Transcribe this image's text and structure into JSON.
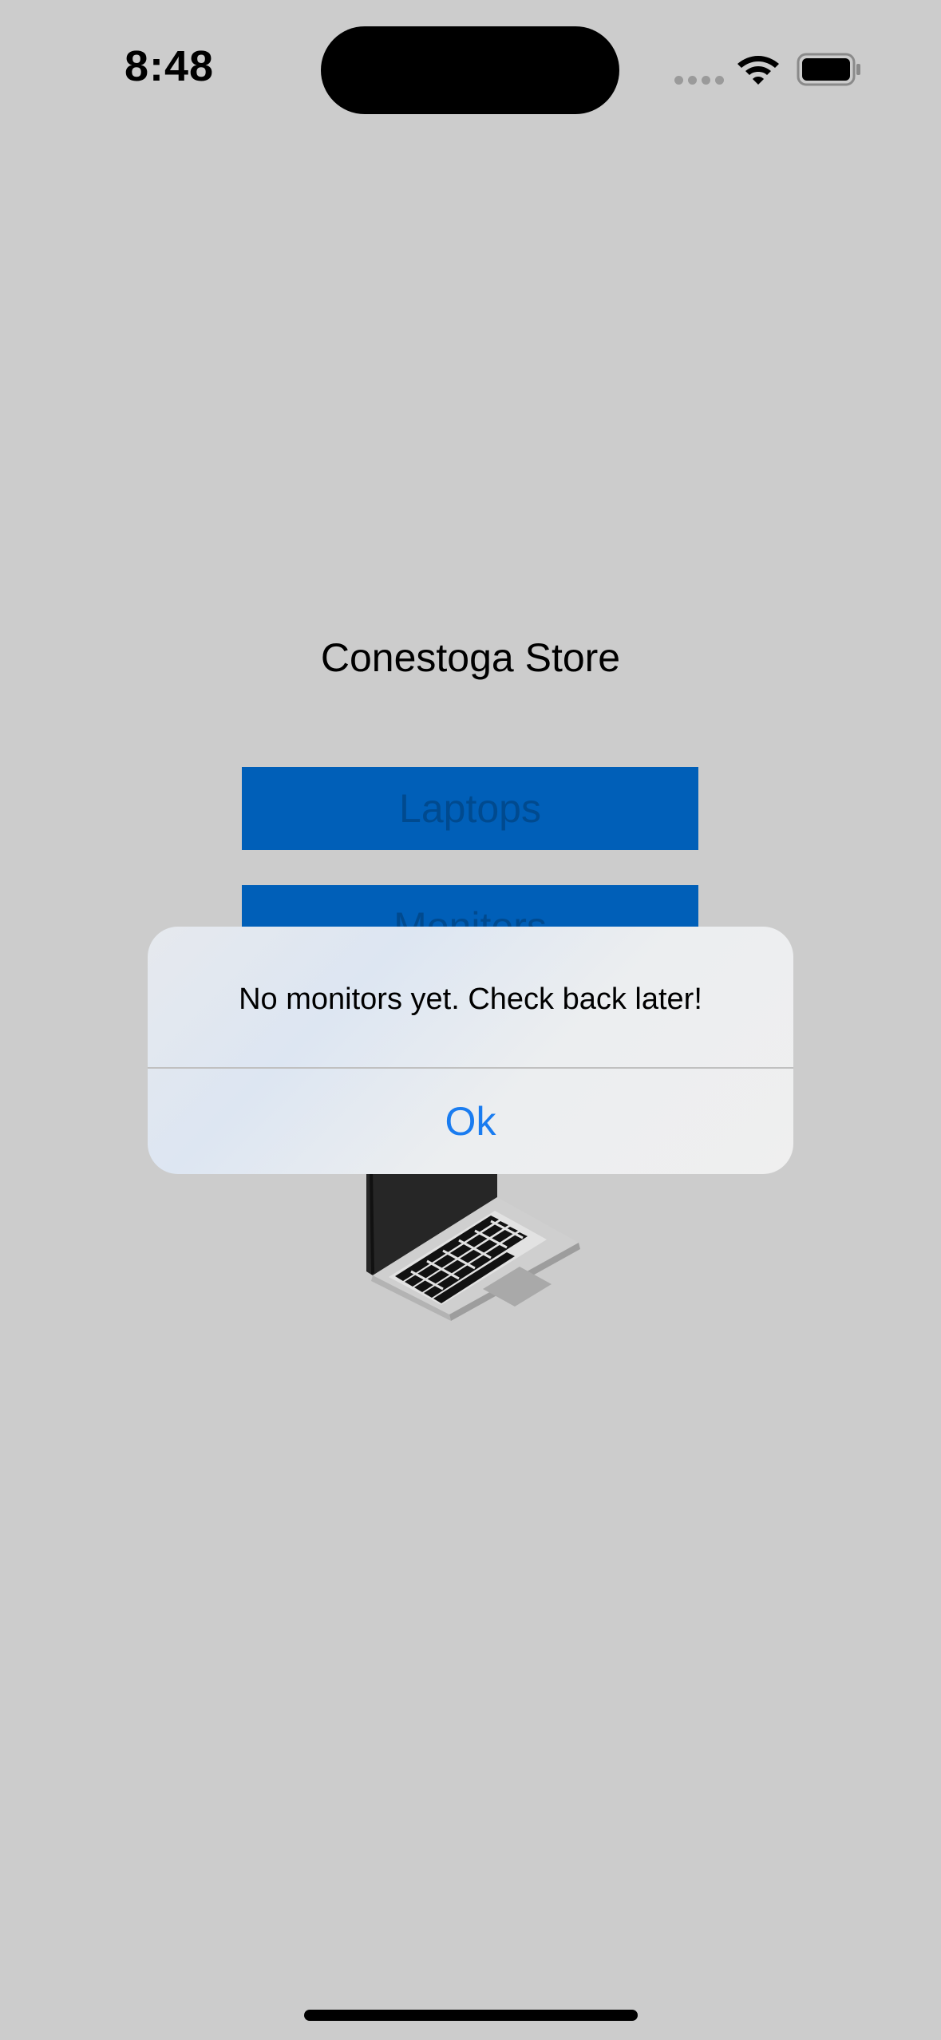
{
  "status_bar": {
    "time": "8:48",
    "signal_icon": "cellular-signal-icon",
    "wifi_icon": "wifi-icon",
    "battery_icon": "battery-icon"
  },
  "main": {
    "title": "Conestoga Store",
    "laptops_button": "Laptops",
    "monitors_button": "Monitors",
    "image_icon": "laptop-image"
  },
  "alert": {
    "message": "No monitors yet. Check back later!",
    "ok_button": "Ok"
  },
  "colors": {
    "background": "#cccccc",
    "button_blue": "#005fb8",
    "alert_link": "#1a7cf0"
  }
}
